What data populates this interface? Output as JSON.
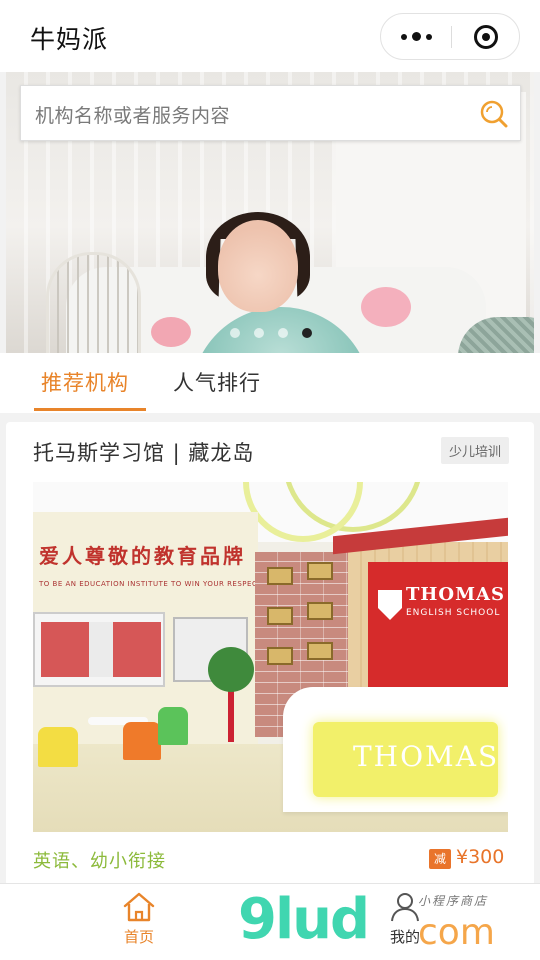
{
  "header": {
    "title": "牛妈派"
  },
  "search": {
    "placeholder": "机构名称或者服务内容"
  },
  "banner": {
    "dots_count": 4,
    "active_index": 3
  },
  "tabs": [
    {
      "label": "推荐机构",
      "active": true
    },
    {
      "label": "人气排行",
      "active": false
    }
  ],
  "card": {
    "title": "托马斯学习馆 | 藏龙岛",
    "badge": "少儿培训",
    "image": {
      "slogan": "爱人尊敬的教育品牌",
      "slogan_en": "TO BE AN EDUCATION INSTITUTE TO WIN YOUR RESPECT",
      "panel_logo": "THOMAS",
      "panel_sub": "ENGLISH SCHOOL",
      "counter_text": "THOMAS"
    },
    "tags": "英语、幼小衔接",
    "discount_label": "减",
    "price": "¥300"
  },
  "bottom_nav": {
    "home_label": "首页",
    "mine_label": "我的"
  },
  "watermark": {
    "brand": "9lud",
    "suffix": "com",
    "cn_text": "小程序商店"
  },
  "colors": {
    "accent": "#e8842a",
    "tag_green": "#8cba3b",
    "search_icon": "#f0a030"
  }
}
